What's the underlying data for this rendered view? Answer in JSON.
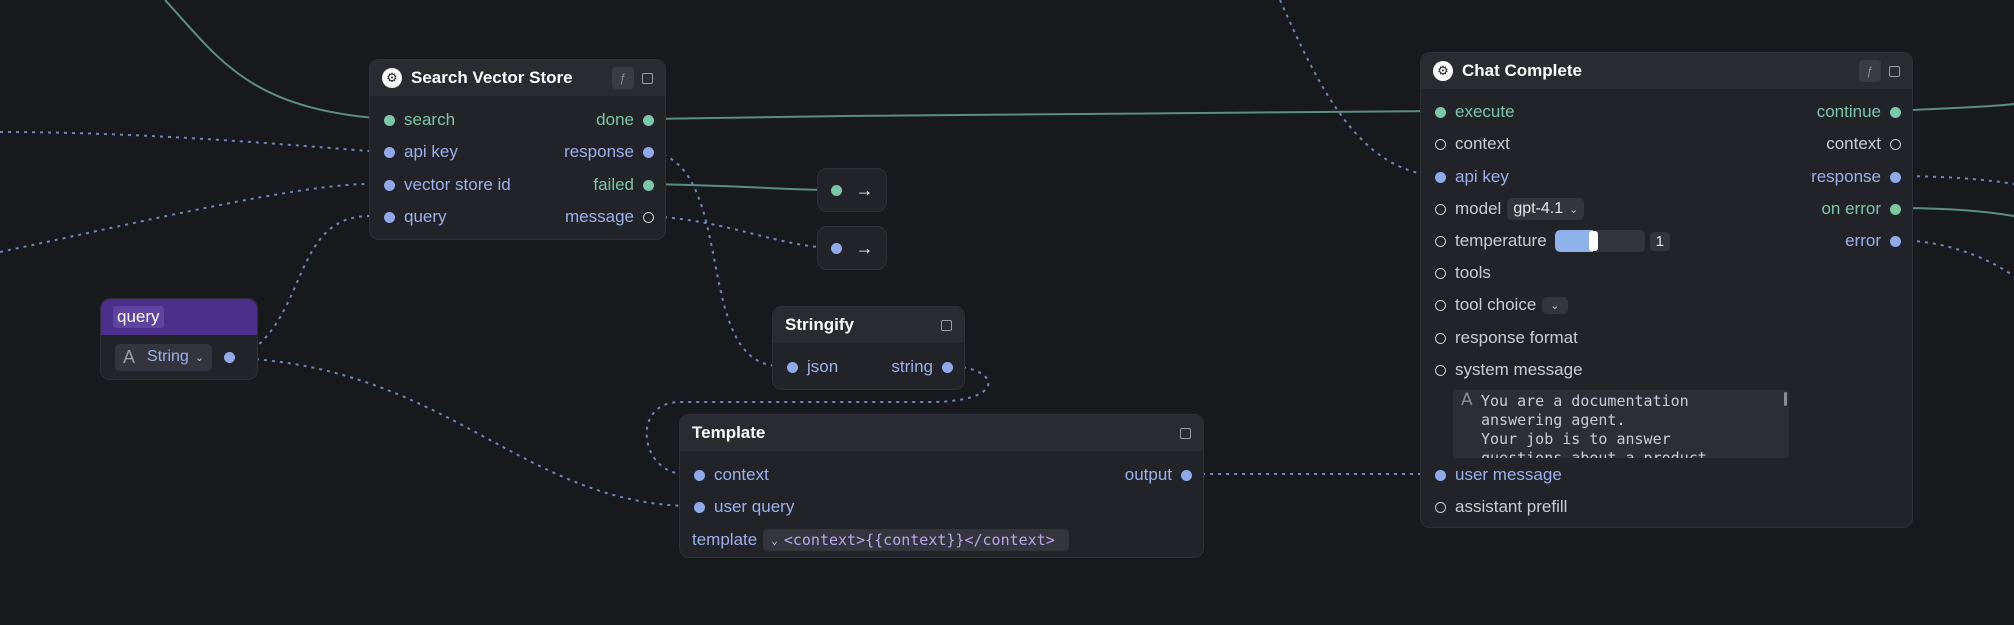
{
  "search_vector_store": {
    "title": "Search Vector Store",
    "inputs": [
      "search",
      "api key",
      "vector store id",
      "query"
    ],
    "outputs": [
      "done",
      "response",
      "failed",
      "message"
    ]
  },
  "chat_complete": {
    "title": "Chat Complete",
    "inputs": [
      "execute",
      "context",
      "api key",
      "model",
      "temperature",
      "tools",
      "tool choice",
      "response format",
      "system message",
      "user message",
      "assistant prefill"
    ],
    "outputs": [
      "continue",
      "context",
      "response",
      "on error",
      "error"
    ],
    "model_value": "gpt-4.1",
    "temperature_value": "1",
    "temperature_level": 0.42,
    "system_message_lines": [
      "You are a documentation",
      "answering agent.",
      "Your job is to answer",
      "questions about a product"
    ]
  },
  "query_node": {
    "title": "query",
    "type_label": "String"
  },
  "stringify": {
    "title": "Stringify",
    "input": "json",
    "output": "string"
  },
  "template": {
    "title": "Template",
    "inputs": [
      "context",
      "user query"
    ],
    "output": "output",
    "template_label": "template",
    "template_value": "<context>{{context}}</context>"
  },
  "icons": {
    "arrow": "→",
    "chevron": "⌄",
    "text_type": "A",
    "logo": "⚙"
  },
  "colors": {
    "exec_port": "#79c7a6",
    "data_port": "#8fa9ea",
    "query_header": "#4b2f8a",
    "canvas": "#18191d"
  }
}
